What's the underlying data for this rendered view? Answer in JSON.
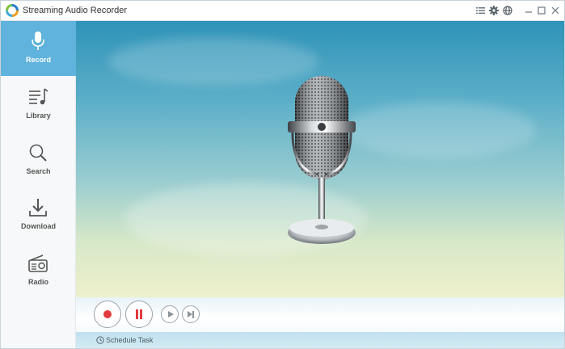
{
  "window": {
    "title": "Streaming Audio Recorder"
  },
  "titlebar_icons": [
    "menu-list-icon",
    "settings-gear-icon",
    "globe-icon",
    "minimize-icon",
    "maximize-icon",
    "close-icon"
  ],
  "sidebar": {
    "items": [
      {
        "label": "Record",
        "icon": "microphone-icon",
        "active": true
      },
      {
        "label": "Library",
        "icon": "music-list-icon",
        "active": false
      },
      {
        "label": "Search",
        "icon": "search-icon",
        "active": false
      },
      {
        "label": "Download",
        "icon": "download-icon",
        "active": false
      },
      {
        "label": "Radio",
        "icon": "radio-icon",
        "active": false
      }
    ]
  },
  "controls": [
    "record-icon",
    "pause-icon",
    "play-icon",
    "skip-next-icon"
  ],
  "status": {
    "schedule_label": "Schedule Task"
  },
  "colors": {
    "accent": "#5fb3dc",
    "record_red": "#e03a3e"
  }
}
